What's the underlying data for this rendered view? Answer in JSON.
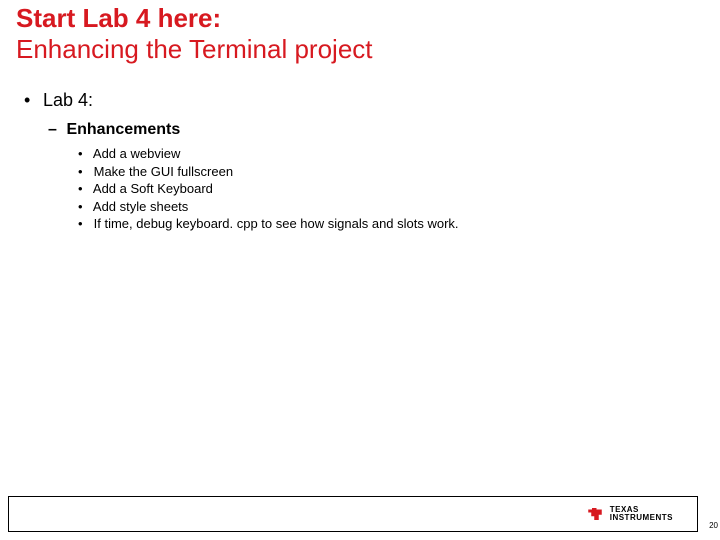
{
  "title": {
    "line1": "Start Lab 4 here:",
    "line2": "Enhancing the Terminal project"
  },
  "body": {
    "lvl1_label": "Lab 4:",
    "lvl2_label": "Enhancements",
    "items": [
      "Add a webview",
      "Make the GUI fullscreen",
      "Add a Soft Keyboard",
      "Add style sheets",
      "If time, debug keyboard. cpp to see how signals and slots work."
    ]
  },
  "footer": {
    "logo_text_line1": "TEXAS",
    "logo_text_line2": "INSTRUMENTS"
  },
  "page_number": "20",
  "colors": {
    "brand_red": "#d71920"
  }
}
